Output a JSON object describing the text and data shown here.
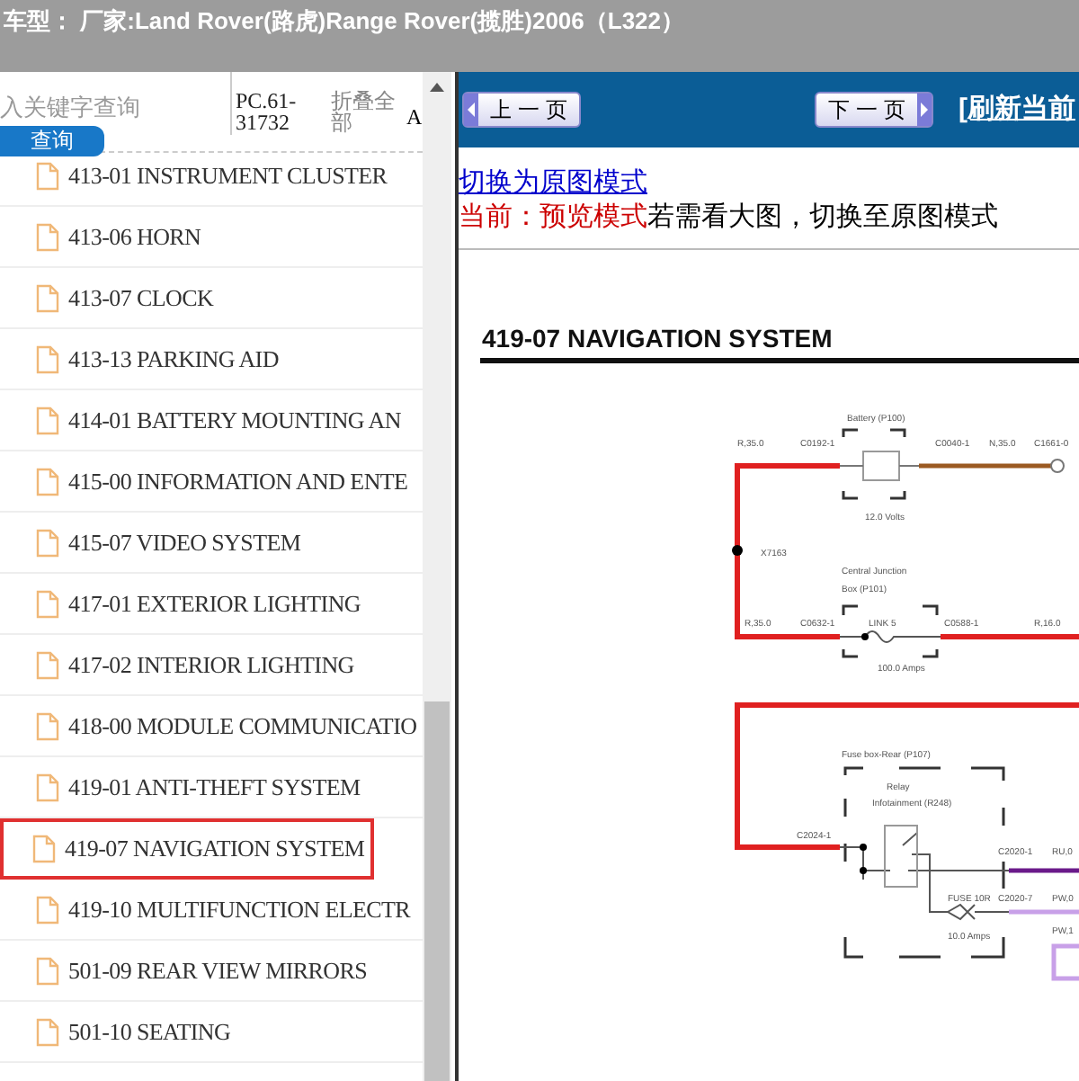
{
  "window": {
    "title": "车型：  厂家:Land Rover(路虎)Range Rover(揽胜)2006（L322）"
  },
  "search": {
    "placeholder": "入关键字查询",
    "button": "查询",
    "code": "PC.61-31732",
    "collapse": "折叠全部",
    "column_4": "A"
  },
  "tree": {
    "items": [
      {
        "label": "413-01 INSTRUMENT CLUSTER",
        "selected": false
      },
      {
        "label": "413-06 HORN",
        "selected": false
      },
      {
        "label": "413-07 CLOCK",
        "selected": false
      },
      {
        "label": "413-13 PARKING AID",
        "selected": false
      },
      {
        "label": "414-01 BATTERY MOUNTING AN",
        "selected": false
      },
      {
        "label": "415-00 INFORMATION AND ENTE",
        "selected": false
      },
      {
        "label": "415-07 VIDEO SYSTEM",
        "selected": false
      },
      {
        "label": "417-01 EXTERIOR LIGHTING",
        "selected": false
      },
      {
        "label": "417-02 INTERIOR LIGHTING",
        "selected": false
      },
      {
        "label": "418-00 MODULE COMMUNICATIO",
        "selected": false
      },
      {
        "label": "419-01 ANTI-THEFT SYSTEM",
        "selected": false
      },
      {
        "label": "419-07 NAVIGATION SYSTEM",
        "selected": true
      },
      {
        "label": "419-10 MULTIFUNCTION ELECTR",
        "selected": false
      },
      {
        "label": "501-09 REAR VIEW MIRRORS",
        "selected": false
      },
      {
        "label": "501-10 SEATING",
        "selected": false
      }
    ]
  },
  "toolbar": {
    "prev": "上 一 页",
    "next": "下 一 页",
    "refresh": "[刷新当前"
  },
  "mode": {
    "link": "切换为原图模式",
    "current": "当前：预览模式",
    "hint": "若需看大图，切换至原图模式"
  },
  "document": {
    "title": "419-07 NAVIGATION SYSTEM",
    "labels": [
      "Battery (P100)",
      "R,35.0",
      "C0192-1",
      "C0040-1",
      "N,35.0",
      "C1661-0",
      "12.0 Volts",
      "X7163",
      "Central Junction",
      "Box (P101)",
      "R,35.0",
      "C0632-1",
      "LINK 5",
      "C0588-1",
      "R,16.0",
      "100.0 Amps",
      "Fuse box-Rear (P107)",
      "Relay",
      "Infotainment (R248)",
      "C2024-1",
      "C2020-1",
      "RU,0",
      "FUSE 10R",
      "C2020-7",
      "PW,0",
      "10.0 Amps",
      "PW,1"
    ]
  }
}
